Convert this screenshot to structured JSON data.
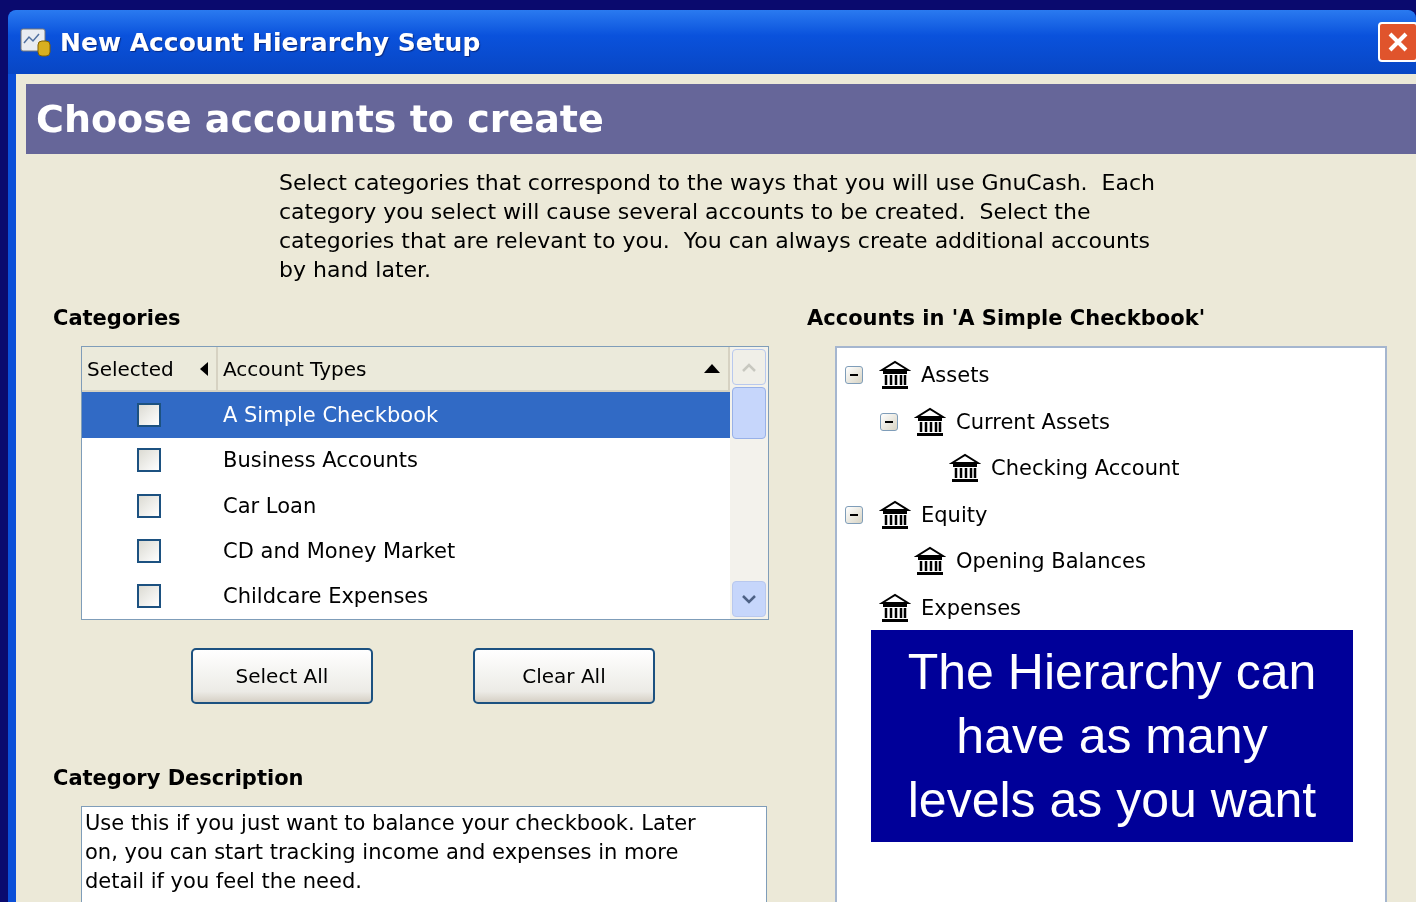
{
  "window": {
    "title": "New Account Hierarchy Setup"
  },
  "page_title": "Choose accounts to create",
  "intro": "Select categories that correspond to the ways that you will use GnuCash.  Each category you select will cause several accounts to be created.  Select the categories that are relevant to you.  You can always create additional accounts by hand later.",
  "categories": {
    "heading": "Categories",
    "columns": [
      "Selected",
      "Account Types"
    ],
    "rows": [
      {
        "label": "A Simple Checkbook",
        "checked": false,
        "selected": true
      },
      {
        "label": "Business Accounts",
        "checked": false,
        "selected": false
      },
      {
        "label": "Car Loan",
        "checked": false,
        "selected": false
      },
      {
        "label": "CD and Money Market",
        "checked": false,
        "selected": false
      },
      {
        "label": "Childcare Expenses",
        "checked": false,
        "selected": false
      }
    ]
  },
  "buttons": [
    "Select All",
    "Clear All"
  ],
  "description": {
    "heading": "Category Description",
    "text": "Use this if you just want to balance your checkbook. Later on, you can start tracking income and expenses in more detail if you feel the need."
  },
  "accounts": {
    "heading": "Accounts in 'A Simple Checkbook'",
    "tree": [
      {
        "label": "Assets",
        "expanded": true,
        "children": [
          {
            "label": "Current Assets",
            "expanded": true,
            "children": [
              {
                "label": "Checking Account"
              }
            ]
          }
        ]
      },
      {
        "label": "Equity",
        "expanded": true,
        "children": [
          {
            "label": "Opening Balances"
          }
        ]
      },
      {
        "label": "Expenses"
      }
    ]
  },
  "callout": "The Hierarchy can have as many levels as you want"
}
